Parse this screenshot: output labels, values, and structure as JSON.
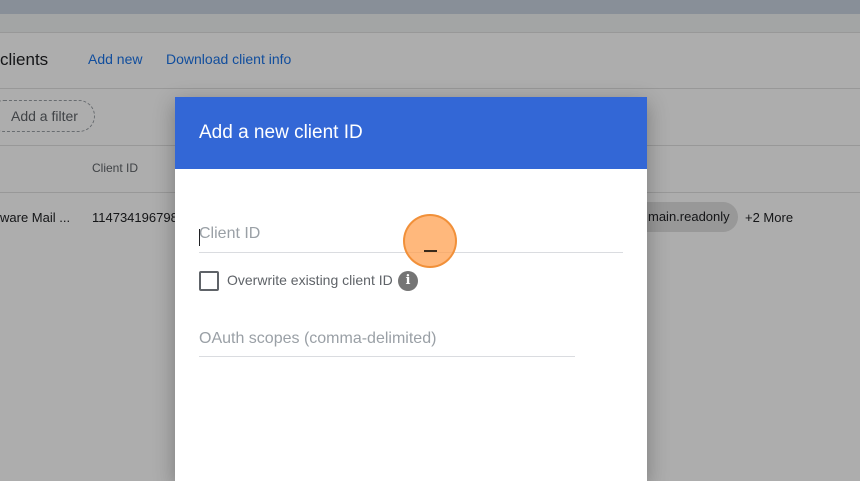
{
  "page": {
    "title": "clients",
    "add_new_link": "Add new",
    "download_link": "Download client info",
    "filter_chip": "Add a filter",
    "table": {
      "columns": [
        "Client ID"
      ],
      "rows": [
        {
          "name": "ware Mail ...",
          "client_id": "114734196798",
          "scope": "main.readonly",
          "more": "+2 More"
        }
      ]
    }
  },
  "dialog": {
    "title": "Add a new client ID",
    "client_id_field": {
      "value": "",
      "placeholder": "Client ID"
    },
    "overwrite_checkbox": {
      "label": "Overwrite existing client ID",
      "checked": false
    },
    "info_icon": "i",
    "scopes_field": {
      "value": "",
      "placeholder": "OAuth scopes (comma-delimited)"
    }
  },
  "colors": {
    "dialog_header": "#3367d6",
    "link": "#1a73e8",
    "scrim": "rgba(0,0,0,0.32)",
    "click_indicator": "#ffa050"
  }
}
